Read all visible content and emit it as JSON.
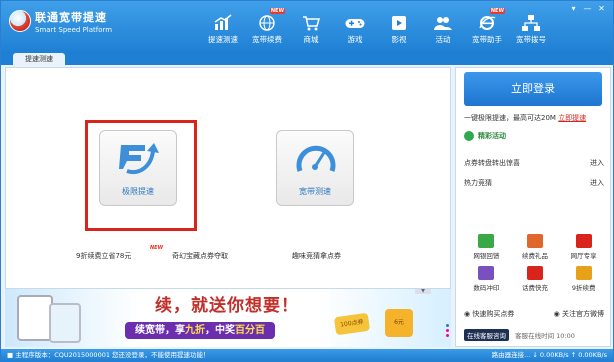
{
  "header": {
    "brand_cn": "联通宽带提速",
    "brand_en": "Smart Speed Platform",
    "nav": [
      {
        "label": "提速测速",
        "icon": "speed-chart-icon",
        "new": false
      },
      {
        "label": "宽带续费",
        "icon": "globe-icon",
        "new": true
      },
      {
        "label": "商城",
        "icon": "cart-icon",
        "new": false
      },
      {
        "label": "游戏",
        "icon": "gamepad-icon",
        "new": false
      },
      {
        "label": "影视",
        "icon": "film-icon",
        "new": false
      },
      {
        "label": "活动",
        "icon": "people-icon",
        "new": false
      },
      {
        "label": "宽带助手",
        "icon": "ie-icon",
        "new": true
      },
      {
        "label": "宽带拨号",
        "icon": "network-icon",
        "new": false
      }
    ],
    "new_badge": "NEW",
    "window_controls": [
      "▾",
      "—",
      "✕"
    ]
  },
  "tab": {
    "label": "提速测速"
  },
  "main": {
    "tile_limit": {
      "label": "极限提速",
      "icon": "speed-arrow-icon"
    },
    "tile_test": {
      "label": "宽带测速",
      "icon": "speedometer-icon"
    },
    "promos": [
      {
        "label": "9折续费立省78元",
        "new": true
      },
      {
        "label": "奇幻宝藏点券夺取",
        "new": false
      },
      {
        "label": "趣味竞猜拿点券",
        "new": false
      }
    ]
  },
  "banner": {
    "slogan": "续，就送你想要！",
    "strip_prefix": "续宽带，享",
    "strip_highlight1": "九折",
    "strip_mid": "，中奖",
    "strip_highlight2": "百分百",
    "coupon": "100点券",
    "gift": "6元"
  },
  "right": {
    "login_label": "立即登录",
    "speed_text": "一键极限提速，最高可达20M",
    "speed_link": "立即提速",
    "section_title": "精彩活动",
    "activities": [
      {
        "label": "点券转盘转出惊喜",
        "go": "进入"
      },
      {
        "label": "热力竞猜",
        "go": "进入"
      }
    ],
    "grid": [
      {
        "label": "网银回馈",
        "icon": "mail-icon",
        "color": "#3aa844"
      },
      {
        "label": "续费礼品",
        "icon": "gift-icon",
        "color": "#e0662b"
      },
      {
        "label": "网厅专享",
        "icon": "unicom-icon",
        "color": "#d9241c"
      },
      {
        "label": "数码冲印",
        "icon": "photo-icon",
        "color": "#7a4fbf"
      },
      {
        "label": "话费快充",
        "icon": "phone-icon",
        "color": "#d9241c"
      },
      {
        "label": "9折续费",
        "icon": "discount-icon",
        "color": "#e8a21a"
      }
    ],
    "quick_buy": "◉ 快速购买点券",
    "weibo": "◉ 关注官方微博",
    "online_service": "在线客服咨询",
    "hotline": "客服在线时间 10:00"
  },
  "status": {
    "left": "■ 主程序版本：CQU2015000001  您还没登录，不能使用提速功能！",
    "right": "路由器连接...  ↓ 0.00KB/s  ↑ 0.00KB/s"
  }
}
